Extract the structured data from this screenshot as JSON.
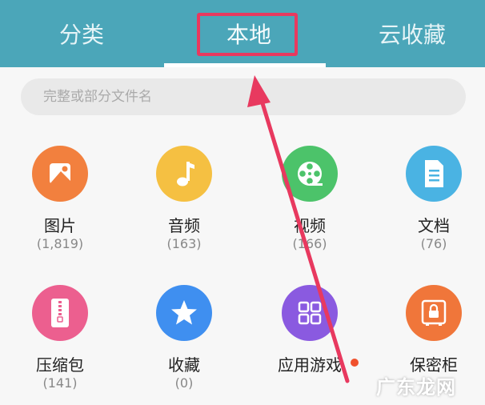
{
  "tabs": [
    {
      "label": "分类"
    },
    {
      "label": "本地"
    },
    {
      "label": "云收藏"
    }
  ],
  "search": {
    "placeholder": "完整或部分文件名"
  },
  "categories": [
    {
      "label": "图片",
      "count": "(1,819)",
      "icon": "image-icon",
      "color": "#f2803e"
    },
    {
      "label": "音频",
      "count": "(163)",
      "icon": "music-note-icon",
      "color": "#f5c042"
    },
    {
      "label": "视频",
      "count": "(166)",
      "icon": "film-reel-icon",
      "color": "#4cc36a"
    },
    {
      "label": "文档",
      "count": "(76)",
      "icon": "document-icon",
      "color": "#4ab3e3"
    },
    {
      "label": "压缩包",
      "count": "(141)",
      "icon": "zip-file-icon",
      "color": "#ec5f8f"
    },
    {
      "label": "收藏",
      "count": "(0)",
      "icon": "star-icon",
      "color": "#3f8ff0"
    },
    {
      "label": "应用游戏",
      "count": "",
      "icon": "apps-grid-icon",
      "color": "#8a5ae0"
    },
    {
      "label": "保密柜",
      "count": "",
      "icon": "safe-lock-icon",
      "color": "#f0763a"
    }
  ],
  "annotation": {
    "color": "#e8395f"
  },
  "watermark": {
    "text": "广东龙网"
  }
}
